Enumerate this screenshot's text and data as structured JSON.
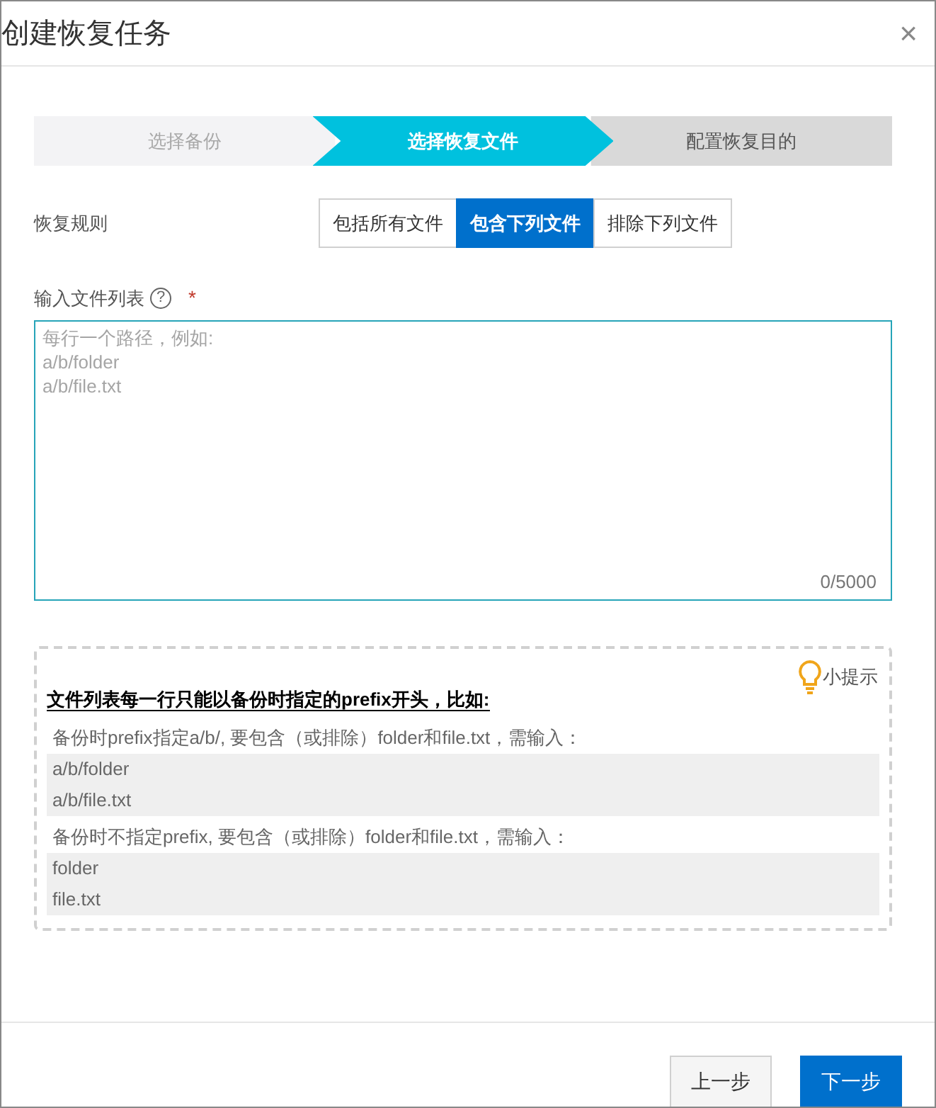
{
  "dialog": {
    "title": "创建恢复任务",
    "close": "×"
  },
  "steps": [
    {
      "label": "选择备份",
      "kind": "done"
    },
    {
      "label": "选择恢复文件",
      "kind": "current"
    },
    {
      "label": "配置恢复目的",
      "kind": "upcoming"
    }
  ],
  "rule": {
    "label": "恢复规则",
    "options": [
      {
        "label": "包括所有文件",
        "selected": false
      },
      {
        "label": "包含下列文件",
        "selected": true
      },
      {
        "label": "排除下列文件",
        "selected": false
      }
    ]
  },
  "file_list": {
    "label": "输入文件列表",
    "help": "?",
    "required_mark": "*",
    "placeholder": "每行一个路径，例如:\na/b/folder\na/b/file.txt",
    "counter": "0/5000"
  },
  "tips": {
    "tag": "小提示",
    "heading": "文件列表每一行只能以备份时指定的prefix开头，比如:",
    "examples": [
      {
        "description": "备份时prefix指定a/b/, 要包含（或排除）folder和file.txt，需输入：",
        "lines": [
          "a/b/folder",
          "a/b/file.txt"
        ]
      },
      {
        "description": "备份时不指定prefix, 要包含（或排除）folder和file.txt，需输入：",
        "lines": [
          "folder",
          "file.txt"
        ]
      }
    ]
  },
  "footer": {
    "buttons": [
      {
        "label": "上一步",
        "kind": "secondary"
      },
      {
        "label": "下一步",
        "kind": "primary"
      }
    ]
  }
}
